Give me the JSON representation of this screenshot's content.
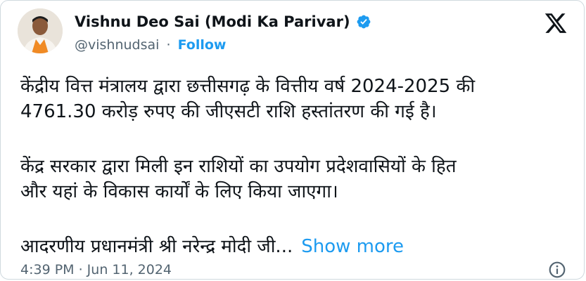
{
  "author": {
    "name": "Vishnu Deo Sai (Modi Ka Parivar)",
    "handle": "@vishnudsai",
    "separator": "·",
    "follow_label": "Follow",
    "verified_icon": "verified-badge-icon",
    "avatar_icon": "profile-avatar"
  },
  "brand": {
    "logo_icon": "x-logo-icon",
    "accent": "#1d9bf0",
    "text": "#0f1419",
    "muted": "#536471"
  },
  "tweet": {
    "line1": "केंद्रीय वित्त मंत्रालय द्वारा छत्तीसगढ़ के वित्तीय वर्ष 2024-2025 की",
    "line2": "4761.30 करोड़ रुपए की जीएसटी राशि हस्तांतरण की गई है।",
    "line3": "केंद्र सरकार द्वारा मिली इन राशियों का उपयोग प्रदेशवासियों के हित",
    "line4": "और यहां के विकास कार्यों के लिए किया जाएगा।",
    "line5": "आदरणीय प्रधानमंत्री श्री नरेन्द्र मोदी जी...",
    "show_more": "Show more"
  },
  "meta": {
    "timestamp": "4:39 PM · Jun 11, 2024",
    "info_icon": "info-icon"
  }
}
